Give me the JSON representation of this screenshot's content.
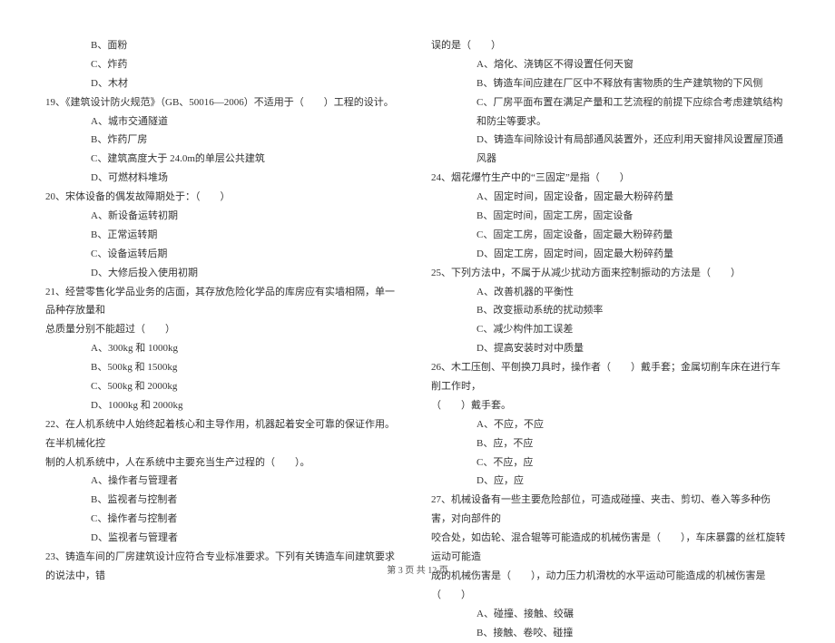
{
  "left": {
    "opts18": {
      "b": "B、面粉",
      "c": "C、炸药",
      "d": "D、木材"
    },
    "q19": {
      "stem": "19、《建筑设计防火规范》（GB、50016—2006）不适用于（　　）工程的设计。",
      "a": "A、城市交通隧道",
      "b": "B、炸药厂房",
      "c": "C、建筑高度大于 24.0m的单层公共建筑",
      "d": "D、可燃材料堆场"
    },
    "q20": {
      "stem": "20、宋体设备的偶发故障期处于：（　　）",
      "a": "A、新设备运转初期",
      "b": "B、正常运转期",
      "c": "C、设备运转后期",
      "d": "D、大修后投入使用初期"
    },
    "q21": {
      "stem1": "21、经营零售化学品业务的店面，其存放危险化学品的库房应有实墙相隔，单一品种存放量和",
      "stem2": "总质量分别不能超过（　　）",
      "a": "A、300kg 和 1000kg",
      "b": "B、500kg 和 1500kg",
      "c": "C、500kg 和 2000kg",
      "d": "D、1000kg 和 2000kg"
    },
    "q22": {
      "stem1": "22、在人机系统中人始终起着核心和主导作用，机器起着安全可靠的保证作用。在半机械化控",
      "stem2": "制的人机系统中，人在系统中主要充当生产过程的（　　）。",
      "a": "A、操作者与管理者",
      "b": "B、监视者与控制者",
      "c": "C、操作者与控制者",
      "d": "D、监视者与管理者"
    },
    "q23": {
      "stem": "23、铸造车间的厂房建筑设计应符合专业标准要求。下列有关铸造车间建筑要求的说法中，错"
    }
  },
  "right": {
    "q23cont": {
      "stem": "误的是（　　）",
      "a": "A、熔化、浇铸区不得设置任何天窗",
      "b": "B、铸造车间应建在厂区中不释放有害物质的生产建筑物的下风侧",
      "c": "C、厂房平面布置在满足产量和工艺流程的前提下应综合考虑建筑结构和防尘等要求。",
      "d": "D、铸造车间除设计有局部通风装置外，还应利用天窗排风设置屋顶通风器"
    },
    "q24": {
      "stem": "24、烟花爆竹生产中的“三固定”是指（　　）",
      "a": "A、固定时间，固定设备，固定最大粉碎药量",
      "b": "B、固定时间，固定工房，固定设备",
      "c": "C、固定工房，固定设备，固定最大粉碎药量",
      "d": "D、固定工房，固定时间，固定最大粉碎药量"
    },
    "q25": {
      "stem": "25、下列方法中，不属于从减少扰动方面来控制振动的方法是（　　）",
      "a": "A、改善机器的平衡性",
      "b": "B、改变振动系统的扰动频率",
      "c": "C、减少构件加工误差",
      "d": "D、提高安装时对中质量"
    },
    "q26": {
      "stem1": "26、木工压刨、平刨换刀具时，操作者（　　）戴手套；金属切削车床在进行车削工作时，",
      "stem2": "（　　）戴手套。",
      "a": "A、不应，不应",
      "b": "B、应，不应",
      "c": "C、不应，应",
      "d": "D、应，应"
    },
    "q27": {
      "stem1": "27、机械设备有一些主要危险部位，可造成碰撞、夹击、剪切、卷入等多种伤害，对向部件的",
      "stem2": "咬合处，如齿轮、混合辊等可能造成的机械伤害是（　　），车床暴露的丝杠旋转运动可能造",
      "stem3": "成的机械伤害是（　　），动力压力机滑枕的水平运动可能造成的机械伤害是（　　）",
      "a": "A、碰撞、接触、绞碾",
      "b": "B、接触、卷咬、碰撞"
    }
  },
  "footer": "第 3 页 共 12 页"
}
